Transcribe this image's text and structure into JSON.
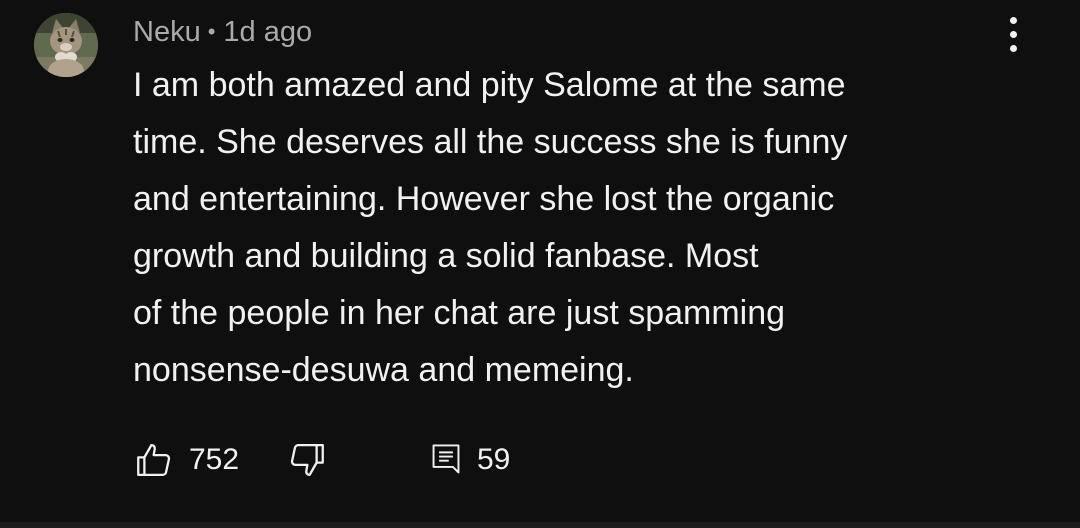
{
  "comment": {
    "author": "Neku",
    "separator": "•",
    "timestamp": "1d ago",
    "text_lines": [
      "I am both amazed and pity Salome at the same",
      "time. She deserves all the success she is funny",
      "and entertaining. However she lost the organic",
      "growth and building a solid fanbase. Most",
      "of the people in her chat are just spamming",
      "nonsense-desuwa and memeing."
    ],
    "like_count": "752",
    "reply_count": "59"
  },
  "icons": {
    "avatar": "cat-avatar",
    "more": "more-vertical-icon",
    "like": "thumbs-up-icon",
    "dislike": "thumbs-down-icon",
    "reply": "comment-icon"
  },
  "colors": {
    "background": "#0f0f0f",
    "text_primary": "#f1f1f1",
    "text_secondary": "#aaaaaa"
  }
}
